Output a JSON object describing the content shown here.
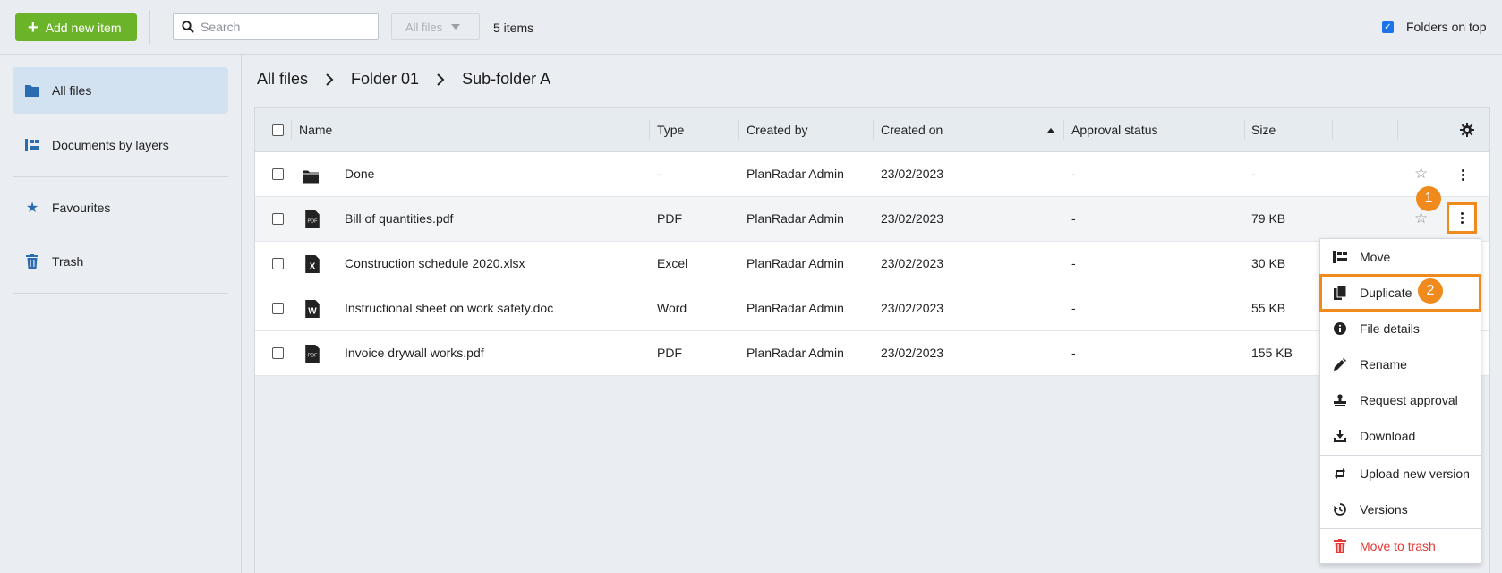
{
  "toolbar": {
    "add_label": "Add new item",
    "search_placeholder": "Search",
    "filter_label": "All files",
    "items_count": "5 items",
    "folders_on_top": "Folders on top"
  },
  "sidebar": {
    "items": [
      {
        "label": "All files",
        "icon": "folder-icon"
      },
      {
        "label": "Documents by layers",
        "icon": "layers-icon"
      },
      {
        "label": "Favourites",
        "icon": "star-icon"
      },
      {
        "label": "Trash",
        "icon": "trash-icon"
      }
    ]
  },
  "breadcrumb": [
    "All files",
    "Folder 01",
    "Sub-folder A"
  ],
  "table": {
    "headers": {
      "name": "Name",
      "type": "Type",
      "created_by": "Created by",
      "created_on": "Created on",
      "approval": "Approval status",
      "size": "Size"
    },
    "rows": [
      {
        "name": "Done",
        "type": "-",
        "created_by": "PlanRadar Admin",
        "created_on": "23/02/2023",
        "approval": "-",
        "size": "-",
        "icon": "folder-icon"
      },
      {
        "name": "Bill of quantities.pdf",
        "type": "PDF",
        "created_by": "PlanRadar Admin",
        "created_on": "23/02/2023",
        "approval": "-",
        "size": "79 KB",
        "icon": "pdf-icon"
      },
      {
        "name": "Construction schedule 2020.xlsx",
        "type": "Excel",
        "created_by": "PlanRadar Admin",
        "created_on": "23/02/2023",
        "approval": "-",
        "size": "30 KB",
        "icon": "excel-icon"
      },
      {
        "name": "Instructional sheet on work safety.doc",
        "type": "Word",
        "created_by": "PlanRadar Admin",
        "created_on": "23/02/2023",
        "approval": "-",
        "size": "55 KB",
        "icon": "word-icon"
      },
      {
        "name": "Invoice drywall works.pdf",
        "type": "PDF",
        "created_by": "PlanRadar Admin",
        "created_on": "23/02/2023",
        "approval": "-",
        "size": "155 KB",
        "icon": "pdf-icon"
      }
    ]
  },
  "badges": {
    "one": "1",
    "two": "2"
  },
  "menu": {
    "items": [
      {
        "label": "Move",
        "icon": "move-icon"
      },
      {
        "label": "Duplicate",
        "icon": "duplicate-icon"
      },
      {
        "label": "File details",
        "icon": "info-icon"
      },
      {
        "label": "Rename",
        "icon": "pencil-icon"
      },
      {
        "label": "Request approval",
        "icon": "stamp-icon"
      },
      {
        "label": "Download",
        "icon": "download-icon"
      },
      {
        "label": "Upload new version",
        "icon": "upload-version-icon"
      },
      {
        "label": "Versions",
        "icon": "history-icon"
      },
      {
        "label": "Move to trash",
        "icon": "trash-icon"
      }
    ]
  },
  "colors": {
    "accent_green": "#6bb42a",
    "highlight_orange": "#f08a1c",
    "active_blue": "#2b6cb0",
    "danger_red": "#e53935"
  }
}
